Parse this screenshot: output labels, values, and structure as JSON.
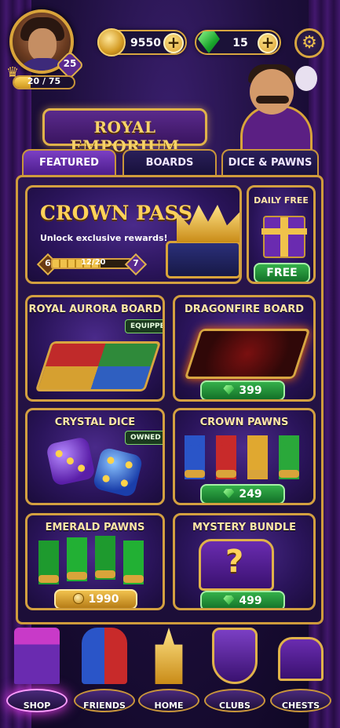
{
  "player": {
    "level": "25",
    "xp": "20 / 75",
    "xp_fraction": 0.27
  },
  "currency": {
    "coins": "9550",
    "gems": "15",
    "plus": "+"
  },
  "settings_icon": "gear-icon",
  "title": "ROYAL EMPORIUM",
  "tabs": [
    {
      "label": "FEATURED",
      "active": true
    },
    {
      "label": "BOARDS",
      "active": false
    },
    {
      "label": "DICE & PAWNS",
      "active": false
    }
  ],
  "crown_pass": {
    "title": "CROWN PASS",
    "subtitle": "Unlock exclusive rewards!",
    "level_current": "6",
    "level_next": "7",
    "progress": "12/20",
    "progress_fraction": 0.6
  },
  "daily": {
    "title": "DAILY FREE",
    "button": "FREE"
  },
  "items": [
    {
      "title": "ROYAL AURORA BOARD",
      "status": "EQUIPPED"
    },
    {
      "title": "DRAGONFIRE BOARD",
      "price": "399",
      "currency": "gems"
    },
    {
      "title": "CRYSTAL DICE",
      "status": "OWNED"
    },
    {
      "title": "CROWN PAWNS",
      "price": "249",
      "currency": "gems"
    },
    {
      "title": "EMERALD PAWNS",
      "price": "1990",
      "currency": "coins"
    },
    {
      "title": "MYSTERY BUNDLE",
      "price": "499",
      "currency": "gems"
    }
  ],
  "nav": [
    {
      "label": "SHOP",
      "active": true
    },
    {
      "label": "FRIENDS",
      "active": false
    },
    {
      "label": "HOME",
      "active": false
    },
    {
      "label": "CLUBS",
      "active": false
    },
    {
      "label": "CHESTS",
      "active": false
    }
  ],
  "colors": {
    "gold": "#d9a43a",
    "purple": "#4b1c8a",
    "green": "#34b04a"
  }
}
